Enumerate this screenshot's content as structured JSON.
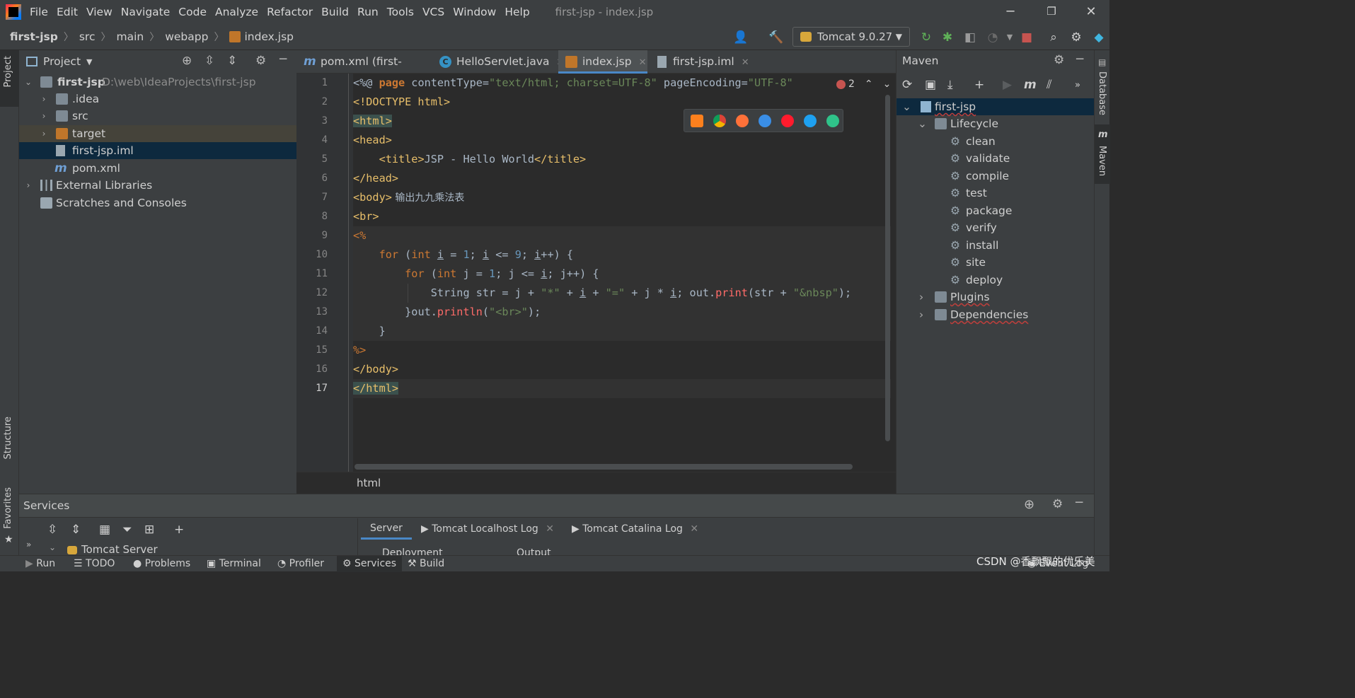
{
  "window": {
    "title": "first-jsp - index.jsp"
  },
  "menu": [
    "File",
    "Edit",
    "View",
    "Navigate",
    "Code",
    "Analyze",
    "Refactor",
    "Build",
    "Run",
    "Tools",
    "VCS",
    "Window",
    "Help"
  ],
  "breadcrumb": [
    "first-jsp",
    "src",
    "main",
    "webapp",
    "index.jsp"
  ],
  "run_config": "Tomcat 9.0.27",
  "project": {
    "header": "Project",
    "root": {
      "name": "first-jsp",
      "path": "D:\\web\\IdeaProjects\\first-jsp"
    },
    "items": [
      ".idea",
      "src",
      "target",
      "first-jsp.iml",
      "pom.xml"
    ],
    "external": "External Libraries",
    "scratches": "Scratches and Consoles"
  },
  "tabs": [
    "pom.xml (first-jsp)",
    "HelloServlet.java",
    "index.jsp",
    "first-jsp.iml"
  ],
  "code": {
    "lines": [
      "1",
      "2",
      "3",
      "4",
      "5",
      "6",
      "7",
      "8",
      "9",
      "10",
      "11",
      "12",
      "13",
      "14",
      "15",
      "16",
      "17"
    ],
    "l1_pre": "<%@ ",
    "l1_page": "page",
    "l1_attr1": " contentType=",
    "l1_val1": "\"text/html; charset=UTF-8\"",
    "l1_attr2": " pageEncoding=",
    "l1_val2": "\"UTF-8\"",
    "l2": "<!DOCTYPE html>",
    "l3": "<html>",
    "l4": "<head>",
    "l5_open": "<title>",
    "l5_text": "JSP - Hello World",
    "l5_close": "</title>",
    "l6": "</head>",
    "l7_tag": "<body>",
    "l7_text": " 输出九九乘法表",
    "l8": "<br>",
    "l9": "<%",
    "l10_for": "for",
    "l10_a": " (",
    "l10_int": "int",
    "l10_b": " ",
    "l10_i": "i",
    "l10_c": " = ",
    "l10_1": "1",
    "l10_d": "; ",
    "l10_i2": "i",
    "l10_e": " <= ",
    "l10_9": "9",
    "l10_f": "; ",
    "l10_i3": "i",
    "l10_g": "++) {",
    "l11_for": "for",
    "l11_a": " (",
    "l11_int": "int",
    "l11_b": " j = ",
    "l11_1": "1",
    "l11_c": "; j <= ",
    "l11_i": "i",
    "l11_d": "; j++) {",
    "l12_a": "String str = j + ",
    "l12_s1": "\"*\"",
    "l12_b": " + ",
    "l12_i": "i",
    "l12_c": " + ",
    "l12_s2": "\"=\"",
    "l12_d": " + j * ",
    "l12_i2": "i",
    "l12_e": "; out.",
    "l12_m": "print",
    "l12_f": "(str + ",
    "l12_s3": "\"&nbsp\"",
    "l12_g": ");",
    "l13_a": "}out.",
    "l13_m": "println",
    "l13_b": "(",
    "l13_s": "\"<br>\"",
    "l13_c": ");",
    "l14": "}",
    "l15": "%>",
    "l16": "</body>",
    "l17": "</html>"
  },
  "error_count": "2",
  "editor_status": "html",
  "maven": {
    "header": "Maven",
    "project": "first-jsp",
    "lifecycle": "Lifecycle",
    "phases": [
      "clean",
      "validate",
      "compile",
      "test",
      "package",
      "verify",
      "install",
      "site",
      "deploy"
    ],
    "plugins": "Plugins",
    "dependencies": "Dependencies"
  },
  "side_tabs": {
    "project": "Project",
    "structure": "Structure",
    "favorites": "Favorites",
    "database": "Database",
    "maven": "Maven"
  },
  "services": {
    "header": "Services",
    "tree_item": "Tomcat Server",
    "tabs": [
      "Server",
      "Tomcat Localhost Log",
      "Tomcat Catalina Log"
    ],
    "col_a": "Deployment",
    "col_b": "Output"
  },
  "bottom_tools": [
    "Run",
    "TODO",
    "Problems",
    "Terminal",
    "Profiler",
    "Services",
    "Build"
  ],
  "event_log": "Event Log",
  "watermark": "CSDN @香飘飘的优乐美",
  "colors": {
    "accent": "#4a88c7",
    "tag": "#e8bf6a",
    "keyword": "#cc7832",
    "string": "#6a8759",
    "number": "#6897bb",
    "method": "#ff6b68"
  }
}
